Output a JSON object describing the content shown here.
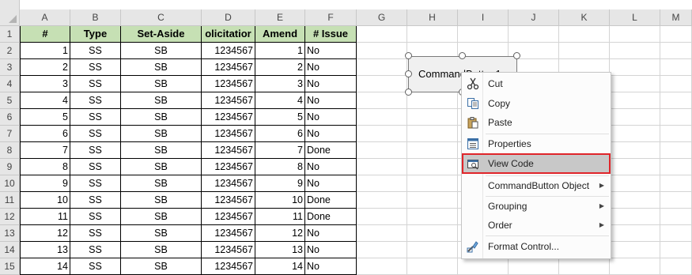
{
  "columns": [
    "A",
    "B",
    "C",
    "D",
    "E",
    "F",
    "G",
    "H",
    "I",
    "J",
    "K",
    "L",
    "M"
  ],
  "rows": [
    "1",
    "2",
    "3",
    "4",
    "5",
    "6",
    "7",
    "8",
    "9",
    "10",
    "11",
    "12",
    "13",
    "14",
    "15"
  ],
  "table": {
    "headers": [
      "#",
      "Type",
      "Set-Aside",
      "olicitatior",
      "Amend",
      "# Issue"
    ],
    "data": [
      [
        "1",
        "SS",
        "SB",
        "1234567",
        "1",
        "No"
      ],
      [
        "2",
        "SS",
        "SB",
        "1234567",
        "2",
        "No"
      ],
      [
        "3",
        "SS",
        "SB",
        "1234567",
        "3",
        "No"
      ],
      [
        "4",
        "SS",
        "SB",
        "1234567",
        "4",
        "No"
      ],
      [
        "5",
        "SS",
        "SB",
        "1234567",
        "5",
        "No"
      ],
      [
        "6",
        "SS",
        "SB",
        "1234567",
        "6",
        "No"
      ],
      [
        "7",
        "SS",
        "SB",
        "1234567",
        "7",
        "Done"
      ],
      [
        "8",
        "SS",
        "SB",
        "1234567",
        "8",
        "No"
      ],
      [
        "9",
        "SS",
        "SB",
        "1234567",
        "9",
        "No"
      ],
      [
        "10",
        "SS",
        "SB",
        "1234567",
        "10",
        "Done"
      ],
      [
        "11",
        "SS",
        "SB",
        "1234567",
        "11",
        "Done"
      ],
      [
        "12",
        "SS",
        "SB",
        "1234567",
        "12",
        "No"
      ],
      [
        "13",
        "SS",
        "SB",
        "1234567",
        "13",
        "No"
      ],
      [
        "14",
        "SS",
        "SB",
        "1234567",
        "14",
        "No"
      ]
    ]
  },
  "command_button": {
    "label": "CommandButton1"
  },
  "context_menu": {
    "items": [
      {
        "label": "Cut",
        "icon": "scissors-icon"
      },
      {
        "label": "Copy",
        "icon": "copy-icon"
      },
      {
        "label": "Paste",
        "icon": "paste-icon"
      },
      {
        "label": "Properties",
        "icon": "properties-icon"
      },
      {
        "label": "View Code",
        "icon": "view-code-icon",
        "highlighted": true
      },
      {
        "label": "CommandButton Object",
        "submenu": true
      },
      {
        "label": "Grouping",
        "submenu": true
      },
      {
        "label": "Order",
        "submenu": true
      },
      {
        "label": "Format Control...",
        "icon": "format-control-icon"
      }
    ]
  },
  "colors": {
    "header_fill": "#c6e0b4",
    "highlight_border": "#e0252a",
    "highlight_fill": "#c8c8c8"
  }
}
